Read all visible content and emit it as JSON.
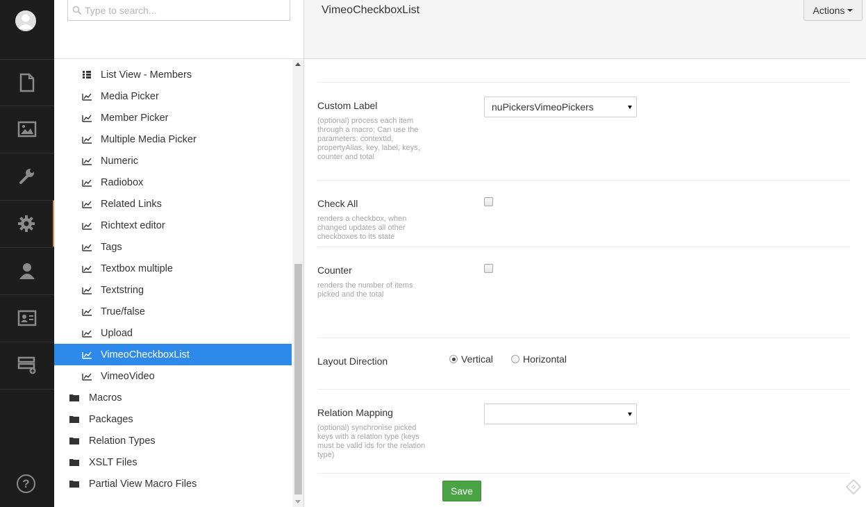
{
  "search": {
    "placeholder": "Type to search..."
  },
  "tree": {
    "items": [
      {
        "label": "List View - Members",
        "icon": "list-icon"
      },
      {
        "label": "Media Picker",
        "icon": "datatype-icon"
      },
      {
        "label": "Member Picker",
        "icon": "datatype-icon"
      },
      {
        "label": "Multiple Media Picker",
        "icon": "datatype-icon"
      },
      {
        "label": "Numeric",
        "icon": "datatype-icon"
      },
      {
        "label": "Radiobox",
        "icon": "datatype-icon"
      },
      {
        "label": "Related Links",
        "icon": "datatype-icon"
      },
      {
        "label": "Richtext editor",
        "icon": "datatype-icon"
      },
      {
        "label": "Tags",
        "icon": "datatype-icon"
      },
      {
        "label": "Textbox multiple",
        "icon": "datatype-icon"
      },
      {
        "label": "Textstring",
        "icon": "datatype-icon"
      },
      {
        "label": "True/false",
        "icon": "datatype-icon"
      },
      {
        "label": "Upload",
        "icon": "datatype-icon"
      },
      {
        "label": "VimeoCheckboxList",
        "icon": "datatype-icon",
        "selected": true
      },
      {
        "label": "VimeoVideo",
        "icon": "datatype-icon"
      }
    ],
    "folders": [
      {
        "label": "Macros",
        "icon": "folder-icon"
      },
      {
        "label": "Packages",
        "icon": "folder-icon"
      },
      {
        "label": "Relation Types",
        "icon": "folder-icon"
      },
      {
        "label": "XSLT Files",
        "icon": "folder-icon"
      },
      {
        "label": "Partial View Macro Files",
        "icon": "folder-icon"
      }
    ]
  },
  "editor": {
    "name": "VimeoCheckboxList",
    "actions_label": "Actions",
    "save_label": "Save",
    "properties": {
      "custom_label": {
        "label": "Custom Label",
        "description": "(optional) process each item through a macro; Can use the parameters: contextId, propertyAlias, key, label, keys, counter and total",
        "value": "nuPickersVimeoPickers"
      },
      "check_all": {
        "label": "Check All",
        "description": "renders a checkbox, when changed updates all other checkboxes to its state",
        "checked": false
      },
      "counter": {
        "label": "Counter",
        "description": "renders the number of items picked and the total",
        "checked": false
      },
      "layout_direction": {
        "label": "Layout Direction",
        "options": [
          "Vertical",
          "Horizontal"
        ],
        "selected": "Vertical"
      },
      "relation_mapping": {
        "label": "Relation Mapping",
        "description": "(optional) synchronise picked keys with a relation type (keys must be valid ids for the relation type)",
        "value": ""
      }
    }
  },
  "colors": {
    "rail_bg": "#1d1d1d",
    "selected_bg": "#2e8aea",
    "save_bg": "#4aa345",
    "active_section_accent": "#e0895b"
  },
  "rail": {
    "sections": [
      "content-icon",
      "media-icon",
      "developer-icon",
      "settings-icon",
      "users-icon",
      "members-icon",
      "forms-icon"
    ],
    "active": "settings-icon",
    "help_glyph": "?"
  }
}
